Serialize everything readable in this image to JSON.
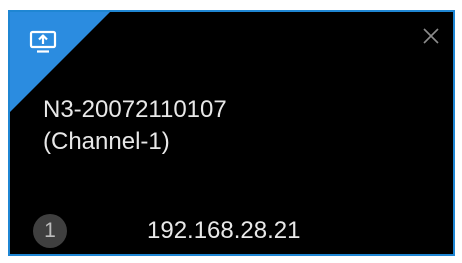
{
  "card": {
    "device_name": "N3-20072110107",
    "channel": "(Channel-1)",
    "index": "1",
    "ip_address": "192.168.28.21",
    "icons": {
      "corner": "screen-share-icon",
      "close": "close-icon"
    }
  },
  "colors": {
    "accent": "#2b8ce0",
    "border": "#1f86d3",
    "background": "#000000",
    "text": "#e8e8e8",
    "badge": "#3f3f3f"
  }
}
